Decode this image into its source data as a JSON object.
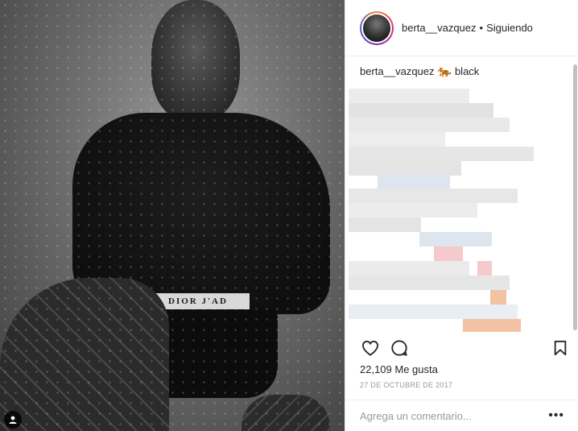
{
  "post": {
    "username": "berta__vazquez",
    "separator": "•",
    "follow_status": "Siguiendo",
    "caption_user": "berta__vazquez",
    "caption_emoji": "🐅",
    "caption_text": "black",
    "image_band_text": "DIOR J'AD",
    "likes": "22,109 Me gusta",
    "date": "27 DE OCTUBRE DE 2017",
    "comment_placeholder": "Agrega un comentario...",
    "more_label": "•••"
  },
  "icons": {
    "like": "heart-icon",
    "comment": "comment-bubble-icon",
    "save": "bookmark-icon",
    "tag": "user-tag-icon"
  },
  "colors": {
    "text": "#262626",
    "muted": "#999999",
    "border": "#efefef",
    "blur_gray": "#e4e4e4",
    "blur_blue": "#dde6ef",
    "blur_pink": "#f6c9cc",
    "blur_peach": "#f3c2a2"
  }
}
